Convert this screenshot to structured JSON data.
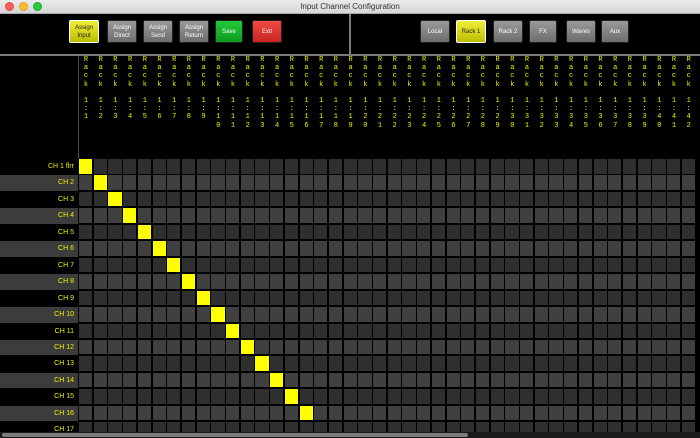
{
  "window": {
    "title": "Input Channel Configuration"
  },
  "toolbar_left": [
    {
      "id": "assign-input",
      "lines": [
        "Assign",
        "Input"
      ],
      "style": "active"
    },
    {
      "id": "assign-direct",
      "lines": [
        "Assign",
        "Direct"
      ],
      "style": "grey"
    },
    {
      "id": "assign-send",
      "lines": [
        "Assign",
        "Send"
      ],
      "style": "grey"
    },
    {
      "id": "assign-return",
      "lines": [
        "Assign",
        "Return"
      ],
      "style": "grey"
    },
    {
      "id": "save",
      "lines": [
        "Save"
      ],
      "style": "green"
    },
    {
      "id": "exit",
      "lines": [
        "Exit"
      ],
      "style": "red"
    }
  ],
  "toolbar_right": [
    {
      "id": "local",
      "lines": [
        "Local"
      ],
      "style": "grey"
    },
    {
      "id": "rack-1",
      "lines": [
        "Rack 1"
      ],
      "style": "active"
    },
    {
      "id": "rack-2",
      "lines": [
        "Rack 2"
      ],
      "style": "grey"
    },
    {
      "id": "fx",
      "lines": [
        "FX"
      ],
      "style": "grey"
    },
    {
      "id": "waves",
      "lines": [
        "Waves"
      ],
      "style": "grey"
    },
    {
      "id": "aux",
      "lines": [
        "Aux"
      ],
      "style": "grey"
    }
  ],
  "columns": [
    "Rack 1:1",
    "Rack 1:2",
    "Rack 1:3",
    "Rack 1:4",
    "Rack 1:5",
    "Rack 1:6",
    "Rack 1:7",
    "Rack 1:8",
    "Rack 1:9",
    "Rack 1:10",
    "Rack 1:11",
    "Rack 1:12",
    "Rack 1:13",
    "Rack 1:14",
    "Rack 1:15",
    "Rack 1:16",
    "Rack 1:17",
    "Rack 1:18",
    "Rack 1:19",
    "Rack 1:20",
    "Rack 1:21",
    "Rack 1:22",
    "Rack 1:23",
    "Rack 1:24",
    "Rack 1:25",
    "Rack 1:26",
    "Rack 1:27",
    "Rack 1:28",
    "Rack 1:29",
    "Rack 1:30",
    "Rack 1:31",
    "Rack 1:32",
    "Rack 1:33",
    "Rack 1:34",
    "Rack 1:35",
    "Rack 1:36",
    "Rack 1:37",
    "Rack 1:38",
    "Rack 1:39",
    "Rack 1:40",
    "Rack 1:41",
    "Rack 1:42"
  ],
  "rows": [
    "CH 1 flrr",
    "CH 2",
    "CH 3",
    "CH 4",
    "CH 5",
    "CH 6",
    "CH 7",
    "CH 8",
    "CH 9",
    "CH 10",
    "CH 11",
    "CH 12",
    "CH 13",
    "CH 14",
    "CH 15",
    "CH 16",
    "CH 17"
  ],
  "assignments": [
    {
      "row": "CH 1 flrr",
      "column": "Rack 1:1"
    },
    {
      "row": "CH 2",
      "column": "Rack 1:2"
    },
    {
      "row": "CH 3",
      "column": "Rack 1:3"
    },
    {
      "row": "CH 4",
      "column": "Rack 1:4"
    },
    {
      "row": "CH 5",
      "column": "Rack 1:5"
    },
    {
      "row": "CH 6",
      "column": "Rack 1:6"
    },
    {
      "row": "CH 7",
      "column": "Rack 1:7"
    },
    {
      "row": "CH 8",
      "column": "Rack 1:8"
    },
    {
      "row": "CH 9",
      "column": "Rack 1:9"
    },
    {
      "row": "CH 10",
      "column": "Rack 1:10"
    },
    {
      "row": "CH 11",
      "column": "Rack 1:11"
    },
    {
      "row": "CH 12",
      "column": "Rack 1:12"
    },
    {
      "row": "CH 13",
      "column": "Rack 1:13"
    },
    {
      "row": "CH 14",
      "column": "Rack 1:14"
    },
    {
      "row": "CH 15",
      "column": "Rack 1:15"
    },
    {
      "row": "CH 16",
      "column": "Rack 1:16"
    }
  ],
  "colors": {
    "accent": "#ffff00",
    "label": "#f0f000",
    "save": "#1fb832",
    "exit": "#e0302a"
  }
}
